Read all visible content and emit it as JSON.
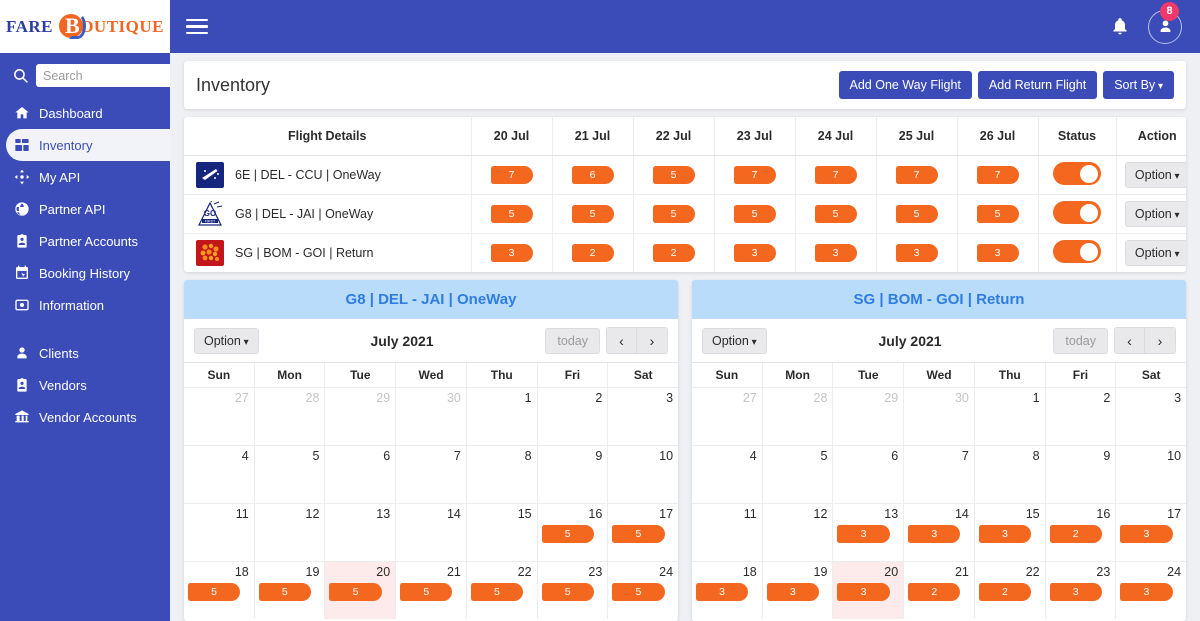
{
  "brand": {
    "left": "FARE",
    "right": "BOUTIQUE",
    "mark": "B"
  },
  "sidebar": {
    "search": {
      "placeholder": "Search",
      "value": ""
    },
    "items": [
      {
        "label": "Dashboard",
        "icon": "home-icon",
        "active": false
      },
      {
        "label": "Inventory",
        "icon": "grid-icon",
        "active": true
      },
      {
        "label": "My API",
        "icon": "move-icon",
        "active": false
      },
      {
        "label": "Partner API",
        "icon": "globe-icon",
        "active": false
      },
      {
        "label": "Partner Accounts",
        "icon": "id-card-icon",
        "active": false
      },
      {
        "label": "Booking History",
        "icon": "calendar-click-icon",
        "active": false
      },
      {
        "label": "Information",
        "icon": "info-box-icon",
        "active": false
      }
    ],
    "items2": [
      {
        "label": "Clients",
        "icon": "user-icon"
      },
      {
        "label": "Vendors",
        "icon": "id-badge-icon"
      },
      {
        "label": "Vendor Accounts",
        "icon": "bank-icon"
      }
    ]
  },
  "topbar": {
    "menu_icon": "hamburger-icon",
    "bell_icon": "bell-icon",
    "avatar_icon": "user-avatar-icon",
    "notification_count": "8"
  },
  "page": {
    "title": "Inventory",
    "add_one_way": "Add One Way Flight",
    "add_return": "Add Return Flight",
    "sort_by": "Sort By"
  },
  "table": {
    "headers": [
      "Flight Details",
      "20 Jul",
      "21 Jul",
      "22 Jul",
      "23 Jul",
      "24 Jul",
      "25 Jul",
      "26 Jul",
      "Status",
      "Action"
    ],
    "rows": [
      {
        "flight": "6E | DEL - CCU | OneWay",
        "airline": "indigo-logo",
        "values": [
          "7",
          "6",
          "5",
          "7",
          "7",
          "7",
          "7"
        ],
        "status": "on",
        "action": "Option"
      },
      {
        "flight": "G8 | DEL - JAI | OneWay",
        "airline": "gofirst-logo",
        "values": [
          "5",
          "5",
          "5",
          "5",
          "5",
          "5",
          "5"
        ],
        "status": "on",
        "action": "Option"
      },
      {
        "flight": "SG | BOM - GOI | Return",
        "airline": "spicejet-logo",
        "values": [
          "3",
          "2",
          "2",
          "3",
          "3",
          "3",
          "3"
        ],
        "status": "on",
        "action": "Option"
      }
    ]
  },
  "calendars": [
    {
      "title": "G8 | DEL - JAI | OneWay",
      "option_label": "Option",
      "month": "July 2021",
      "today_label": "today",
      "prev": "‹",
      "next": "›",
      "dow": [
        "Sun",
        "Mon",
        "Tue",
        "Wed",
        "Thu",
        "Fri",
        "Sat"
      ],
      "weeks": [
        [
          {
            "d": "27",
            "other": true
          },
          {
            "d": "28",
            "other": true
          },
          {
            "d": "29",
            "other": true
          },
          {
            "d": "30",
            "other": true
          },
          {
            "d": "1"
          },
          {
            "d": "2"
          },
          {
            "d": "3"
          }
        ],
        [
          {
            "d": "4"
          },
          {
            "d": "5"
          },
          {
            "d": "6"
          },
          {
            "d": "7"
          },
          {
            "d": "8"
          },
          {
            "d": "9"
          },
          {
            "d": "10"
          }
        ],
        [
          {
            "d": "11"
          },
          {
            "d": "12"
          },
          {
            "d": "13"
          },
          {
            "d": "14"
          },
          {
            "d": "15"
          },
          {
            "d": "16",
            "ev": "5"
          },
          {
            "d": "17",
            "ev": "5"
          }
        ],
        [
          {
            "d": "18",
            "ev": "5"
          },
          {
            "d": "19",
            "ev": "5"
          },
          {
            "d": "20",
            "ev": "5",
            "today": true
          },
          {
            "d": "21",
            "ev": "5"
          },
          {
            "d": "22",
            "ev": "5"
          },
          {
            "d": "23",
            "ev": "5"
          },
          {
            "d": "24",
            "ev": "5"
          }
        ]
      ]
    },
    {
      "title": "SG | BOM - GOI | Return",
      "option_label": "Option",
      "month": "July 2021",
      "today_label": "today",
      "prev": "‹",
      "next": "›",
      "dow": [
        "Sun",
        "Mon",
        "Tue",
        "Wed",
        "Thu",
        "Fri",
        "Sat"
      ],
      "weeks": [
        [
          {
            "d": "27",
            "other": true
          },
          {
            "d": "28",
            "other": true
          },
          {
            "d": "29",
            "other": true
          },
          {
            "d": "30",
            "other": true
          },
          {
            "d": "1"
          },
          {
            "d": "2"
          },
          {
            "d": "3"
          }
        ],
        [
          {
            "d": "4"
          },
          {
            "d": "5"
          },
          {
            "d": "6"
          },
          {
            "d": "7"
          },
          {
            "d": "8"
          },
          {
            "d": "9"
          },
          {
            "d": "10"
          }
        ],
        [
          {
            "d": "11"
          },
          {
            "d": "12"
          },
          {
            "d": "13",
            "ev": "3"
          },
          {
            "d": "14",
            "ev": "3"
          },
          {
            "d": "15",
            "ev": "3"
          },
          {
            "d": "16",
            "ev": "2"
          },
          {
            "d": "17",
            "ev": "3"
          }
        ],
        [
          {
            "d": "18",
            "ev": "3"
          },
          {
            "d": "19",
            "ev": "3"
          },
          {
            "d": "20",
            "ev": "3",
            "today": true
          },
          {
            "d": "21",
            "ev": "2"
          },
          {
            "d": "22",
            "ev": "2"
          },
          {
            "d": "23",
            "ev": "3"
          },
          {
            "d": "24",
            "ev": "3"
          }
        ]
      ]
    }
  ],
  "colors": {
    "brand_blue": "#3b4cb8",
    "accent_orange": "#f4671f",
    "cal_header_bg": "#b9dcfb",
    "cal_header_text": "#2f7de1",
    "badge_red": "#f0396a",
    "today_bg": "#fdeaea"
  }
}
